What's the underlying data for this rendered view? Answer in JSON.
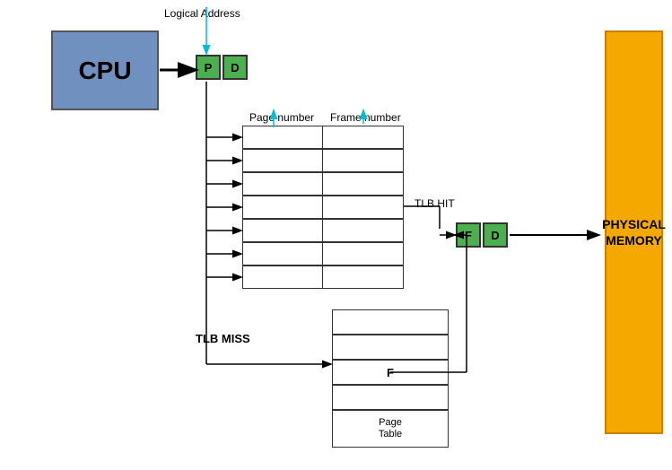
{
  "cpu": {
    "label": "CPU",
    "colors": {
      "bg": "#7090c0",
      "border": "#555555"
    }
  },
  "logical_address_label": "Logical Address",
  "pd_boxes": [
    {
      "id": "P",
      "label": "P"
    },
    {
      "id": "D",
      "label": "D"
    }
  ],
  "fd_boxes": [
    {
      "id": "F",
      "label": "F"
    },
    {
      "id": "D2",
      "label": "D"
    }
  ],
  "tlb": {
    "page_number_label": "Page number",
    "frame_number_label": "Frame number",
    "hit_label": "TLB HIT",
    "rows": 7
  },
  "page_table": {
    "miss_label": "TLB MISS",
    "f_label": "F",
    "page_table_label": "Page\nTable",
    "rows": 5
  },
  "physical_memory": {
    "label": "PHYSICAL\nMEMORY"
  }
}
